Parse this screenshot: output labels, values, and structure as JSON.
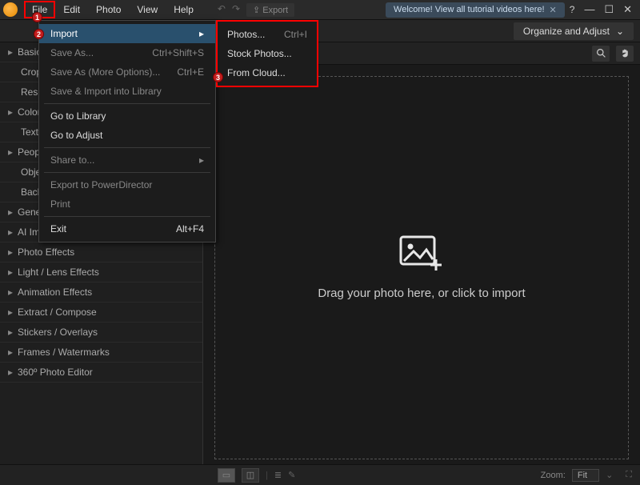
{
  "menubar": [
    "File",
    "Edit",
    "Photo",
    "View",
    "Help"
  ],
  "export_btn": "Export",
  "welcome": "Welcome! View all tutorial videos here!",
  "mode_btn": "Organize and Adjust",
  "sidebar": [
    {
      "label": "Basic",
      "type": "header"
    },
    {
      "label": "Crop",
      "type": "sub"
    },
    {
      "label": "Resiz",
      "type": "sub"
    },
    {
      "label": "Color",
      "type": "header"
    },
    {
      "label": "Text E",
      "type": "sub"
    },
    {
      "label": "People",
      "type": "header"
    },
    {
      "label": "Objec",
      "type": "sub"
    },
    {
      "label": "Backg",
      "type": "sub"
    },
    {
      "label": "Gene",
      "type": "header"
    },
    {
      "label": "AI Improvements",
      "type": "header"
    },
    {
      "label": "Photo Effects",
      "type": "header"
    },
    {
      "label": "Light / Lens Effects",
      "type": "header"
    },
    {
      "label": "Animation Effects",
      "type": "header"
    },
    {
      "label": "Extract / Compose",
      "type": "header"
    },
    {
      "label": "Stickers / Overlays",
      "type": "header"
    },
    {
      "label": "Frames / Watermarks",
      "type": "header"
    },
    {
      "label": "360º Photo Editor",
      "type": "header"
    }
  ],
  "drop_text": "Drag your photo here, or click to import",
  "zoom_label": "Zoom:",
  "zoom_value": "Fit",
  "file_menu": [
    {
      "label": "Import",
      "shortcut": "",
      "enabled": true,
      "hover": true,
      "arrow": true
    },
    {
      "label": "Save As...",
      "shortcut": "Ctrl+Shift+S",
      "enabled": false
    },
    {
      "label": "Save As (More Options)...",
      "shortcut": "Ctrl+E",
      "enabled": false
    },
    {
      "label": "Save & Import into Library",
      "shortcut": "",
      "enabled": false
    },
    {
      "sep": true
    },
    {
      "label": "Go to Library",
      "shortcut": "",
      "enabled": true
    },
    {
      "label": "Go to Adjust",
      "shortcut": "",
      "enabled": true
    },
    {
      "sep": true
    },
    {
      "label": "Share to...",
      "shortcut": "",
      "enabled": false,
      "arrow": true
    },
    {
      "sep": true
    },
    {
      "label": "Export to PowerDirector",
      "shortcut": "",
      "enabled": false
    },
    {
      "label": "Print",
      "shortcut": "",
      "enabled": false
    },
    {
      "sep": true
    },
    {
      "label": "Exit",
      "shortcut": "Alt+F4",
      "enabled": true
    }
  ],
  "import_submenu": [
    {
      "label": "Photos...",
      "shortcut": "Ctrl+I"
    },
    {
      "label": "Stock Photos...",
      "shortcut": ""
    },
    {
      "label": "From Cloud...",
      "shortcut": ""
    }
  ],
  "badges": [
    "1",
    "2",
    "3"
  ]
}
